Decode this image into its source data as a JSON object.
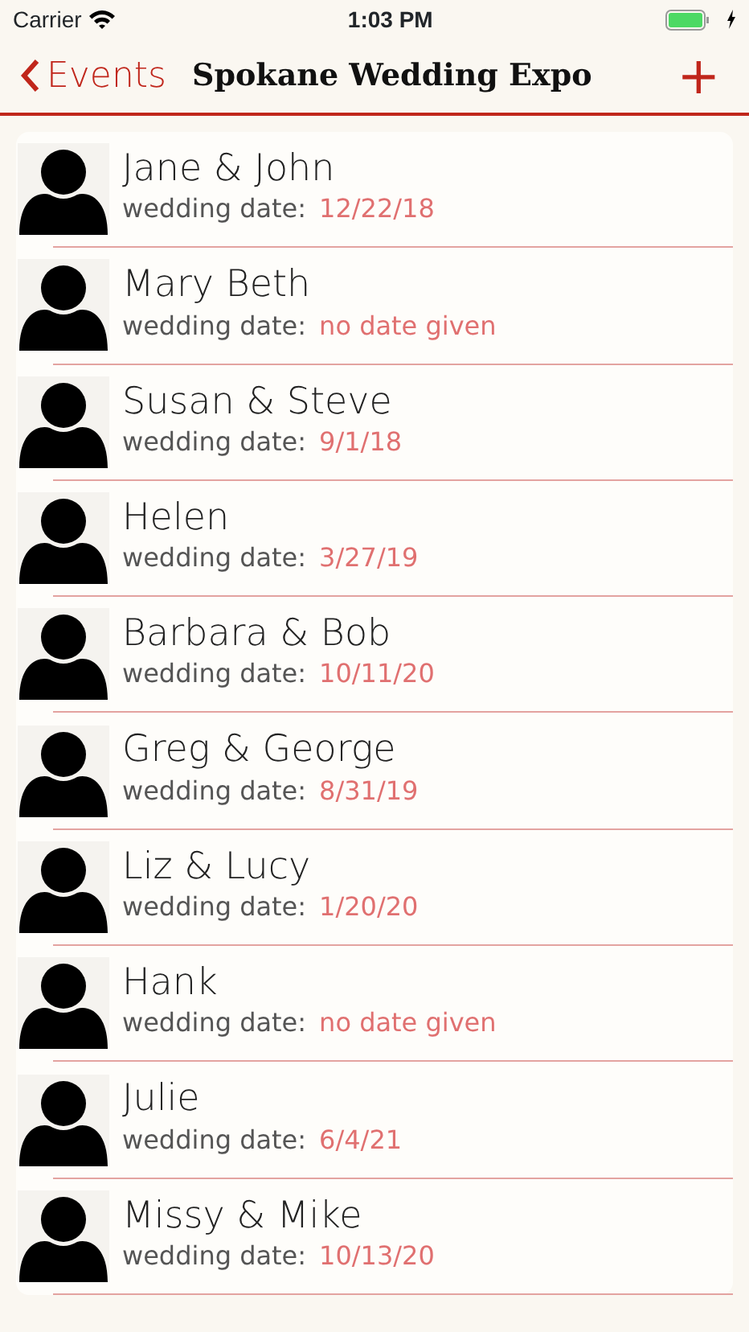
{
  "status_bar": {
    "carrier": "Carrier",
    "time": "1:03 PM",
    "charging": true
  },
  "nav": {
    "back": "Events",
    "title": "Spokane Wedding Expo",
    "add": "+"
  },
  "clients": [
    {
      "name": "Jane & John",
      "label": "wedding date:",
      "date": "12/22/18"
    },
    {
      "name": "Mary Beth",
      "label": "wedding date:",
      "date": "no date given"
    },
    {
      "name": "Susan & Steve",
      "label": "wedding date:",
      "date": "9/1/18"
    },
    {
      "name": "Helen",
      "label": "wedding date:",
      "date": "3/27/19"
    },
    {
      "name": "Barbara & Bob",
      "label": "wedding date:",
      "date": "10/11/20"
    },
    {
      "name": "Greg  & George",
      "label": "wedding date:",
      "date": "8/31/19"
    },
    {
      "name": "Liz & Lucy",
      "label": "wedding date:",
      "date": "1/20/20"
    },
    {
      "name": "Hank",
      "label": "wedding date:",
      "date": "no date given"
    },
    {
      "name": "Julie",
      "label": "wedding date:",
      "date": "6/4/21"
    },
    {
      "name": "Missy & Mike",
      "label": "wedding date:",
      "date": "10/13/20"
    }
  ]
}
